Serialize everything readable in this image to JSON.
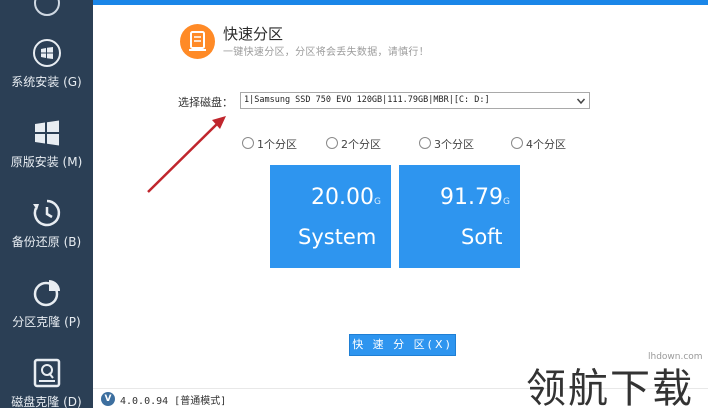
{
  "sidebar": {
    "items": [
      {
        "label": "系统安装 (G)",
        "icon": "windows-icon"
      },
      {
        "label": "原版安装 (M)",
        "icon": "windows-tiles-icon"
      },
      {
        "label": "备份还原 (B)",
        "icon": "clock-restore-icon"
      },
      {
        "label": "分区克隆 (P)",
        "icon": "pie-chart-icon"
      },
      {
        "label": "磁盘克隆 (D)",
        "icon": "disk-icon"
      }
    ]
  },
  "header": {
    "title": "快速分区",
    "subtitle": "一键快速分区，分区将会丢失数据，请慎行！"
  },
  "disk": {
    "label": "选择磁盘：",
    "selected": "1|Samsung SSD 750 EVO 120GB|111.79GB|MBR|[C:   D:]"
  },
  "partition_count": {
    "options": [
      "1个分区",
      "2个分区",
      "3个分区",
      "4个分区"
    ]
  },
  "partitions": [
    {
      "size": "20.00",
      "unit": "G",
      "name": "System"
    },
    {
      "size": "91.79",
      "unit": "G",
      "name": "Soft"
    }
  ],
  "actions": {
    "quick_partition_label": "快 速 分 区(X)"
  },
  "status": {
    "version": "4.0.0.94 [普通模式]"
  },
  "watermark": {
    "site": "lhdown.com",
    "text": "领航下载"
  },
  "colors": {
    "sidebar_bg": "#2b3f55",
    "accent_blue": "#2e95ef",
    "title_icon_orange": "#ff8a26",
    "arrow_red": "#c0262d"
  }
}
